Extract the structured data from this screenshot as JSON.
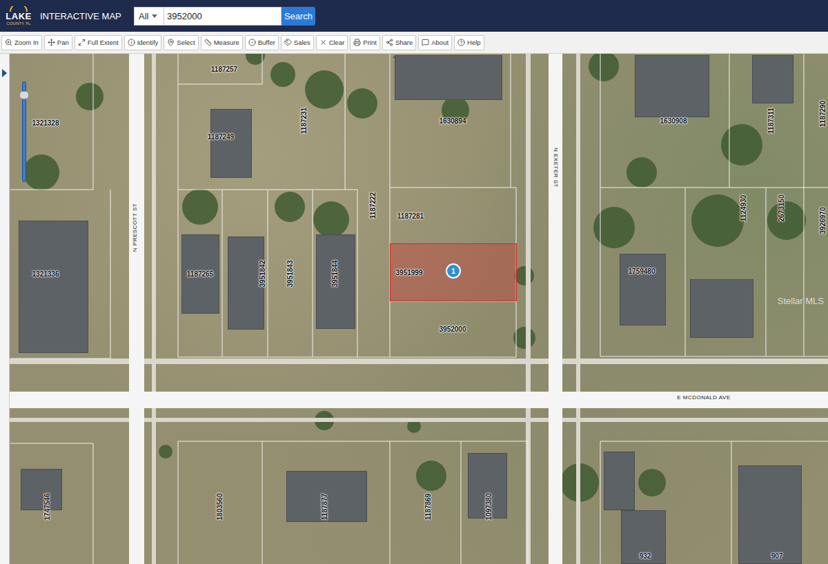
{
  "header": {
    "logo": {
      "name": "LAKE",
      "sub": "COUNTY, FL"
    },
    "title": "INTERACTIVE MAP",
    "search": {
      "scope": "All",
      "value": "3952000",
      "button": "Search"
    }
  },
  "toolbar": [
    {
      "label": "Zoom In"
    },
    {
      "label": "Pan"
    },
    {
      "label": "Full Extent"
    },
    {
      "label": "Identify"
    },
    {
      "label": "Select"
    },
    {
      "label": "Measure"
    },
    {
      "label": "Buffer"
    },
    {
      "label": "Sales"
    },
    {
      "label": "Clear"
    },
    {
      "label": "Print"
    },
    {
      "label": "Share"
    },
    {
      "label": "About"
    },
    {
      "label": "Help"
    }
  ],
  "sidebar": {
    "expanded": false
  },
  "zoom": {
    "level": 0.9
  },
  "map": {
    "parcels": [
      {
        "id": "1187257",
        "selected": false
      },
      {
        "id": "1321328",
        "selected": false
      },
      {
        "id": "1187249",
        "selected": false
      },
      {
        "id": "1187231",
        "selected": false
      },
      {
        "id": "1630894",
        "selected": false
      },
      {
        "id": "1630908",
        "selected": false
      },
      {
        "id": "1187311",
        "selected": false
      },
      {
        "id": "1187290",
        "selected": false
      },
      {
        "id": "1187222",
        "selected": false
      },
      {
        "id": "1187281",
        "selected": false
      },
      {
        "id": "1124930",
        "selected": false
      },
      {
        "id": "2673150",
        "selected": false
      },
      {
        "id": "3926970",
        "selected": false
      },
      {
        "id": "1321336",
        "selected": false
      },
      {
        "id": "1187265",
        "selected": false
      },
      {
        "id": "3951842",
        "selected": false
      },
      {
        "id": "3951843",
        "selected": false
      },
      {
        "id": "3951844",
        "selected": false
      },
      {
        "id": "3951999",
        "selected": true
      },
      {
        "id": "1759480",
        "selected": false
      },
      {
        "id": "3952000",
        "selected": false
      },
      {
        "id": "1747546",
        "selected": false
      },
      {
        "id": "1803560",
        "selected": false
      },
      {
        "id": "1187877",
        "selected": false
      },
      {
        "id": "1187869",
        "selected": false
      },
      {
        "id": "1097380",
        "selected": false
      },
      {
        "id": "932",
        "selected": false
      },
      {
        "id": "907",
        "selected": false
      }
    ],
    "streets": [
      {
        "name": "N PRESCOTT ST"
      },
      {
        "name": "N EXETER ST"
      },
      {
        "name": "E MCDONALD AVE"
      }
    ],
    "marker": "1",
    "watermark": "Stellar MLS"
  }
}
